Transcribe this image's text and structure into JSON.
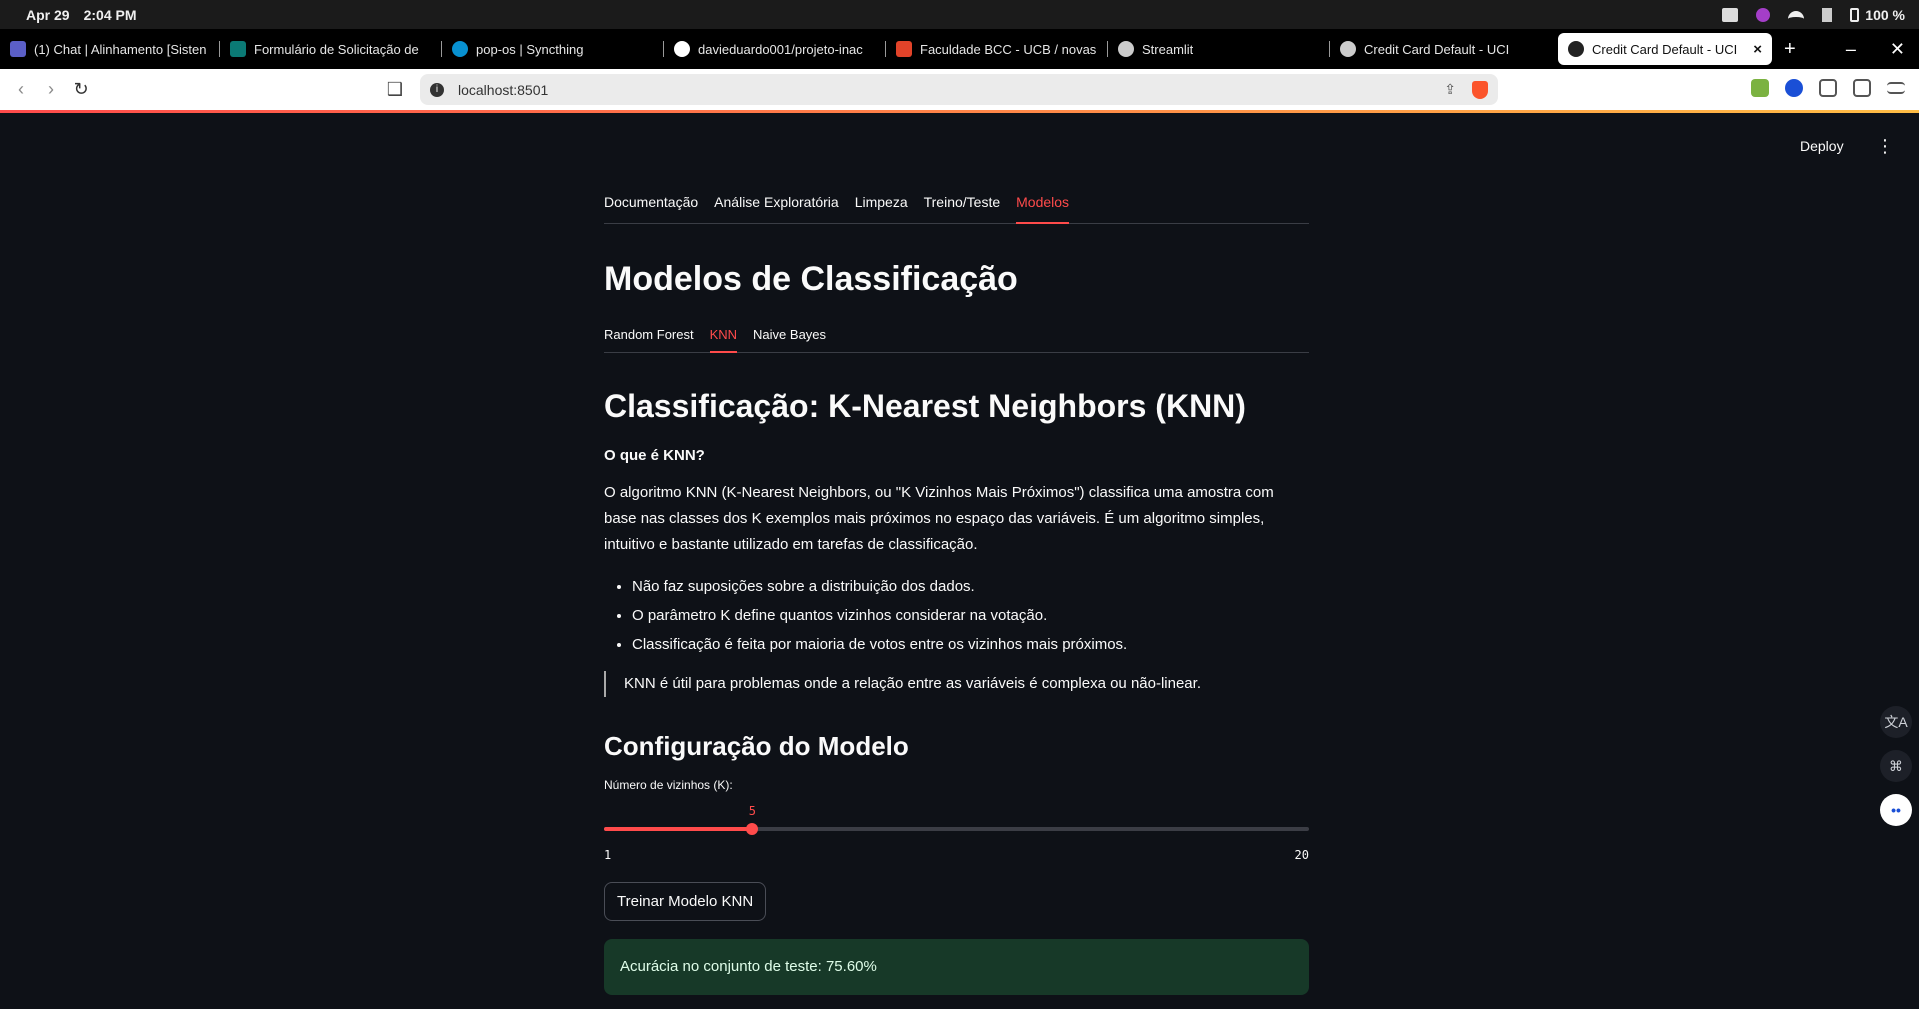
{
  "os": {
    "date": "Apr 29",
    "time": "2:04 PM",
    "battery": "100 %"
  },
  "browser": {
    "tabs": [
      {
        "label": "(1) Chat | Alinhamento [Sisten",
        "favicon_color": "#5b5fc7"
      },
      {
        "label": "Formulário de Solicitação de",
        "favicon_color": "#0b7a75"
      },
      {
        "label": "pop-os | Syncthing",
        "favicon_color": "#0891d1"
      },
      {
        "label": "davieduardo001/projeto-inac",
        "favicon_color": "#ffffff"
      },
      {
        "label": "Faculdade BCC - UCB / novas",
        "favicon_color": "#e24329"
      },
      {
        "label": "Streamlit",
        "favicon_color": "#cccccc"
      },
      {
        "label": "Credit Card Default - UCI",
        "favicon_color": "#cccccc"
      }
    ],
    "active_tab": {
      "label": "Credit Card Default - UCI",
      "close": "×"
    },
    "new_tab": "+",
    "url": "localhost:8501"
  },
  "app": {
    "deploy_label": "Deploy",
    "kebab": "⋮",
    "main_tabs": [
      "Documentação",
      "Análise Exploratória",
      "Limpeza",
      "Treino/Teste",
      "Modelos"
    ],
    "active_main_tab": 4,
    "page_title": "Modelos de Classificação",
    "sub_tabs": [
      "Random Forest",
      "KNN",
      "Naive Bayes"
    ],
    "active_sub_tab": 1,
    "section_title": "Classificação: K-Nearest Neighbors (KNN)",
    "question": "O que é KNN?",
    "description": "O algoritmo KNN (K-Nearest Neighbors, ou \"K Vizinhos Mais Próximos\") classifica uma amostra com base nas classes dos K exemplos mais próximos no espaço das variáveis. É um algoritmo simples, intuitivo e bastante utilizado em tarefas de classificação.",
    "bullets": [
      "Não faz suposições sobre a distribuição dos dados.",
      "O parâmetro K define quantos vizinhos considerar na votação.",
      "Classificação é feita por maioria de votos entre os vizinhos mais próximos."
    ],
    "quote": "KNN é útil para problemas onde a relação entre as variáveis é complexa ou não-linear.",
    "config_title": "Configuração do Modelo",
    "slider": {
      "label": "Número de vizinhos (K):",
      "min": 1,
      "max": 20,
      "value": 5
    },
    "train_button": "Treinar Modelo KNN",
    "result": "Acurácia no conjunto de teste: 75.60%"
  },
  "colors": {
    "accent": "#ff4b4b",
    "background": "#0e1117",
    "success_bg": "#173928"
  }
}
